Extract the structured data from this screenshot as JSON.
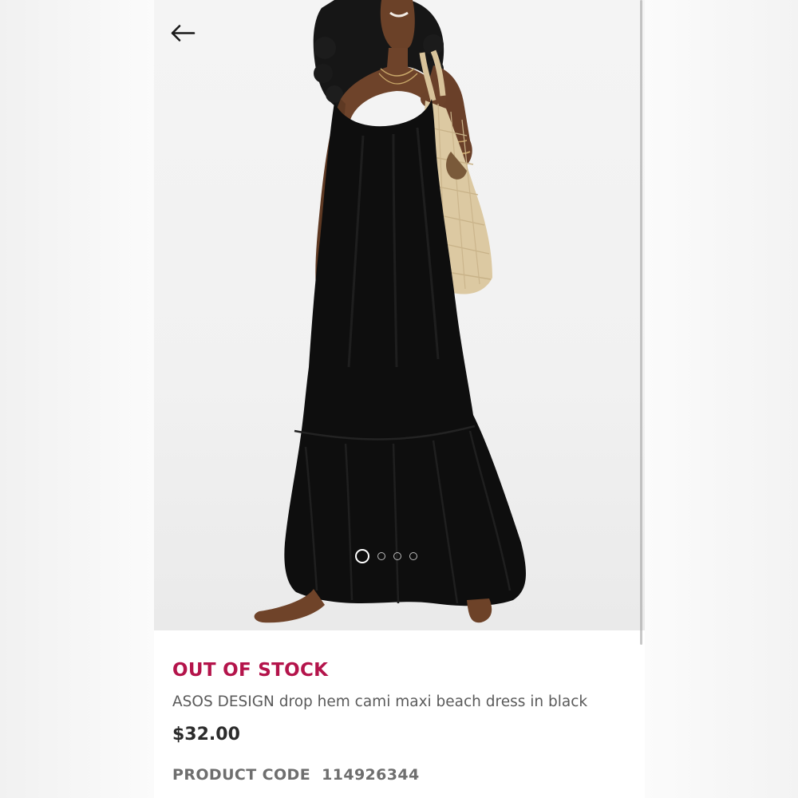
{
  "navigation": {
    "back_icon": "arrow-left-icon"
  },
  "gallery": {
    "image_alt": "Model wearing a black drop hem cami maxi beach dress with a woven straw tote bag",
    "image_count": 4,
    "active_index": 0
  },
  "product": {
    "stock_status": "OUT OF STOCK",
    "name": "ASOS DESIGN drop hem cami maxi beach dress in black",
    "price": "$32.00",
    "code_label": "PRODUCT CODE",
    "code_value": "114926344"
  },
  "colors": {
    "out_of_stock": "#b4144b",
    "price": "#2b2b2b",
    "name": "#5a5a5a",
    "code": "#6e6e6e"
  }
}
